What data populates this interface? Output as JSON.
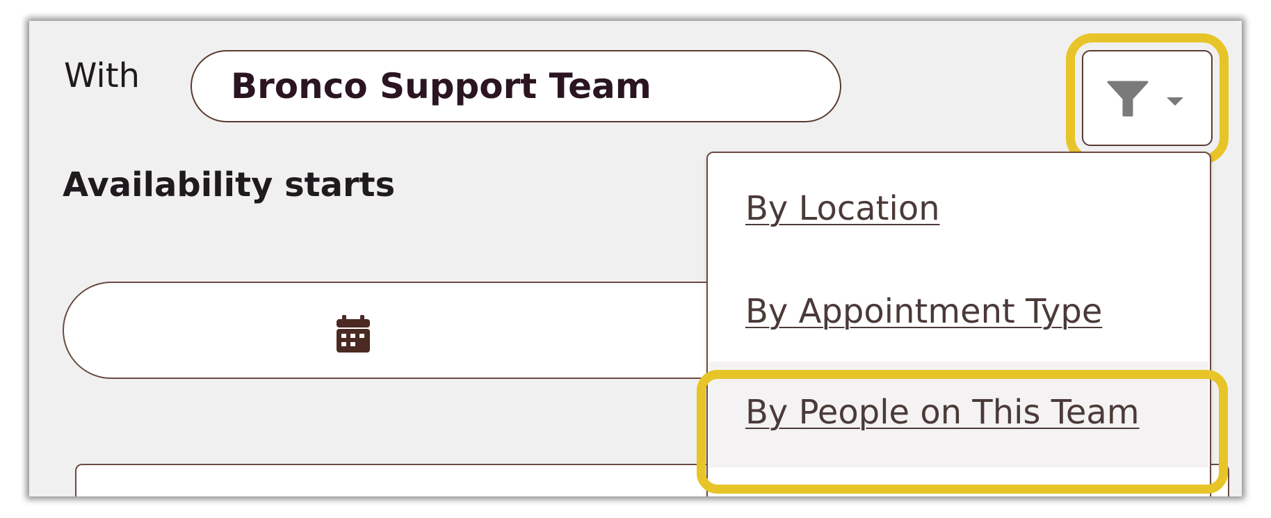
{
  "form": {
    "with_label": "With",
    "team_value": "Bronco Support Team",
    "availability_label": "Availability starts"
  },
  "filter_menu": {
    "items": [
      {
        "label": "By Location"
      },
      {
        "label": "By Appointment Type"
      },
      {
        "label": "By People on This Team",
        "highlighted": true
      }
    ]
  },
  "icons": {
    "calendar": "calendar-icon",
    "filter": "funnel-icon",
    "caret": "caret-down-icon"
  },
  "colors": {
    "highlight": "#e7c428",
    "border": "#5a3a30",
    "text_dark": "#2a1521",
    "icon_gray": "#7a7a7a",
    "calendar_icon": "#4a2a22"
  }
}
